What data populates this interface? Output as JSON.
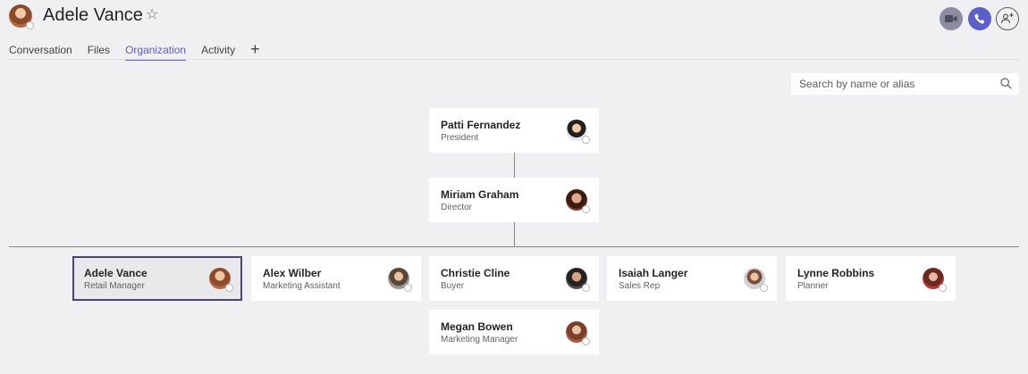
{
  "header": {
    "title": "Adele Vance",
    "star_icon": "star-outline-icon",
    "buttons": {
      "video": "video-camera-icon",
      "call": "phone-icon",
      "add_people": "add-people-icon"
    },
    "colors": {
      "accent": "#5b5fc7",
      "video_bg": "#8b8ca1"
    }
  },
  "tabs": [
    {
      "label": "Conversation",
      "active": false
    },
    {
      "label": "Files",
      "active": false
    },
    {
      "label": "Organization",
      "active": true
    },
    {
      "label": "Activity",
      "active": false
    }
  ],
  "tab_add": "+",
  "search": {
    "placeholder": "Search by name or alias",
    "value": ""
  },
  "org": {
    "managers": [
      {
        "name": "Patti Fernandez",
        "role": "President"
      },
      {
        "name": "Miriam Graham",
        "role": "Director"
      }
    ],
    "peers": [
      {
        "name": "Adele Vance",
        "role": "Retail Manager",
        "selected": true
      },
      {
        "name": "Alex Wilber",
        "role": "Marketing Assistant"
      },
      {
        "name": "Christie Cline",
        "role": "Buyer"
      },
      {
        "name": "Isaiah Langer",
        "role": "Sales Rep"
      },
      {
        "name": "Lynne Robbins",
        "role": "Planner"
      },
      {
        "name": "Megan Bowen",
        "role": "Marketing Manager"
      }
    ]
  }
}
